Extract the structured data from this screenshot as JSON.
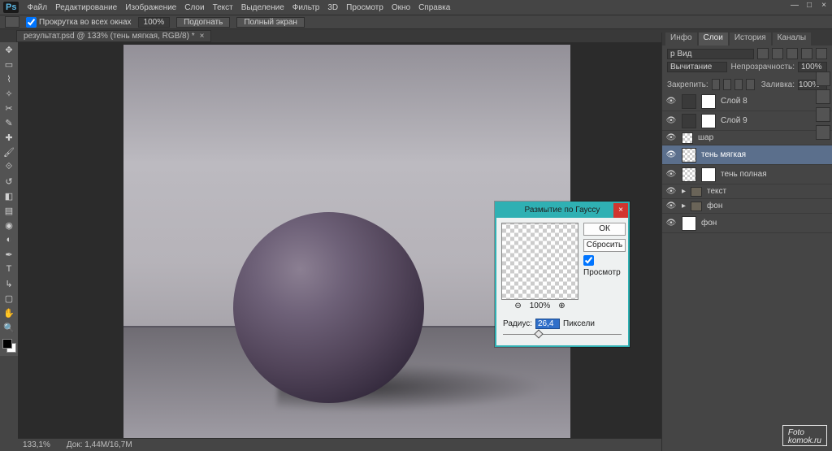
{
  "app": {
    "ps_label": "Ps"
  },
  "menu": {
    "items": [
      "Файл",
      "Редактирование",
      "Изображение",
      "Слои",
      "Текст",
      "Выделение",
      "Фильтр",
      "3D",
      "Просмотр",
      "Окно",
      "Справка"
    ]
  },
  "optbar": {
    "scroll_all": "Прокрутка во всех окнах",
    "zoom": "100%",
    "fit": "Подогнать",
    "fullscreen": "Полный экран"
  },
  "doc": {
    "tab": "результат.psd @ 133% (тень мягкая, RGB/8) *",
    "tab_close": "×"
  },
  "status": {
    "zoom": "133,1%",
    "info": "Док: 1,44М/16,7М"
  },
  "panels": {
    "info": "Инфо",
    "layers": "Слои",
    "history": "История",
    "channels": "Каналы",
    "kind_label": "p Вид",
    "blend_mode": "Вычитание",
    "opacity_label": "Непрозрачность:",
    "opacity_value": "100%",
    "lock_label": "Закрепить:",
    "fill_label": "Заливка:",
    "fill_value": "100%"
  },
  "layers": [
    {
      "name": "Слой 8",
      "thumb": "dark",
      "mask": true
    },
    {
      "name": "Слой 9",
      "thumb": "dark",
      "mask": true
    },
    {
      "name": "шар",
      "thumb": "checker"
    },
    {
      "name": "тень мягкая",
      "thumb": "checker",
      "selected": true
    },
    {
      "name": "тень полная",
      "thumb": "checker",
      "mask": true
    },
    {
      "name": "текст",
      "folder": true
    },
    {
      "name": "фон",
      "folder": true
    },
    {
      "name": "фон",
      "thumb": "white"
    }
  ],
  "dialog": {
    "title": "Размытие по Гауссу",
    "ok": "ОК",
    "reset": "Сбросить",
    "preview": "Просмотр",
    "zoom_pct": "100%",
    "radius_label": "Радиус:",
    "radius_value": "26,4",
    "units": "Пиксели"
  },
  "watermark": {
    "line1": "Foto",
    "line2": "komok.ru"
  }
}
